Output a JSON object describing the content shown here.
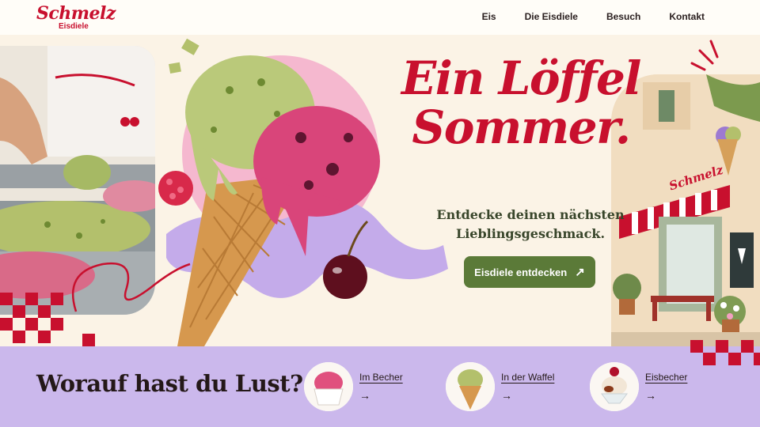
{
  "brand": {
    "name": "Schmelz",
    "sub": "Eisdiele"
  },
  "nav": {
    "items": [
      "Eis",
      "Die Eisdiele",
      "Besuch",
      "Kontakt"
    ]
  },
  "hero": {
    "headline_line1": "Ein Löffel",
    "headline_line2": "Sommer.",
    "subline_line1": "Entdecke deinen nächsten",
    "subline_line2": "Lieblingsgeschmack.",
    "cta_label": "Eisdiele entdecken",
    "cta_icon": "arrow-up-right-icon",
    "shop_sign": "Schmelz"
  },
  "categories": {
    "title": "Worauf hast du Lust?",
    "items": [
      {
        "label": "Im Becher",
        "icon": "arrow-right-icon"
      },
      {
        "label": "In der Waffel",
        "icon": "arrow-right-icon"
      },
      {
        "label": "Eisbecher",
        "icon": "arrow-right-icon"
      }
    ]
  },
  "colors": {
    "brand_red": "#c8102e",
    "cta_green": "#5b7a38",
    "lavender": "#cbb8ec",
    "cream": "#fbf3e6",
    "pistachio": "#b9c67a",
    "berry": "#d9457a"
  }
}
